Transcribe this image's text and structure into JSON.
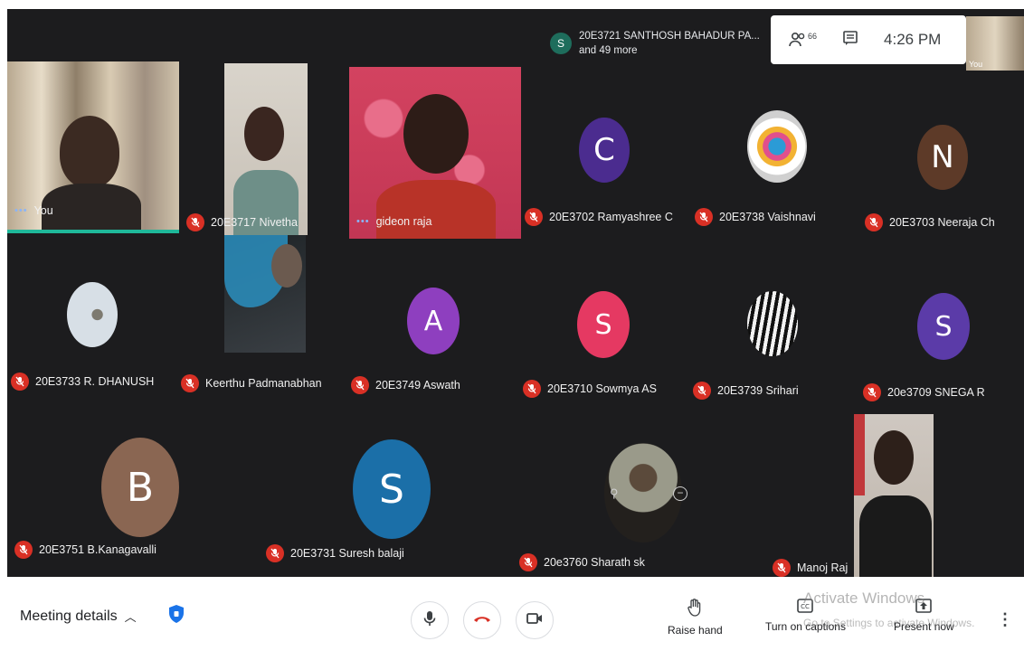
{
  "presenter": {
    "initial": "S",
    "name": "20E3721 SANTHOSH BAHADUR PA...",
    "more": "and 49 more"
  },
  "top_bar": {
    "participants_icon": "people-icon",
    "participants_count": "66",
    "chat_icon": "chat-icon",
    "time": "4:26 PM",
    "self_view_label": "You"
  },
  "tiles": [
    {
      "name": "You",
      "type": "video",
      "speaking": true
    },
    {
      "name": "20E3717 Nivetha",
      "type": "video",
      "muted": true
    },
    {
      "name": "gideon raja",
      "type": "video",
      "speaking": true
    },
    {
      "name": "20E3702 Ramyashree C",
      "type": "avatar",
      "initial": "C",
      "color": "#4b2c8f",
      "muted": true
    },
    {
      "name": "20E3738 Vaishnavi",
      "type": "photo",
      "muted": true
    },
    {
      "name": "20E3703 Neeraja Ch",
      "type": "avatar",
      "initial": "N",
      "color": "#5d3a28",
      "muted": true
    },
    {
      "name": "20E3733 R. DHANUSH",
      "type": "photo",
      "muted": true
    },
    {
      "name": "Keerthu Padmanabhan",
      "type": "video",
      "muted": true
    },
    {
      "name": "20E3749 Aswath",
      "type": "avatar",
      "initial": "A",
      "color": "#8e3fbf",
      "muted": true
    },
    {
      "name": "20E3710 Sowmya AS",
      "type": "avatar",
      "initial": "S",
      "color": "#e53962",
      "muted": true
    },
    {
      "name": "20E3739 Srihari",
      "type": "photo",
      "muted": true
    },
    {
      "name": "20e3709 SNEGA R",
      "type": "avatar",
      "initial": "S",
      "color": "#5b3ba8",
      "muted": true
    },
    {
      "name": "20E3751 B.Kanagavalli",
      "type": "avatar",
      "initial": "B",
      "color": "#8a6652",
      "muted": true
    },
    {
      "name": "20E3731 Suresh balaji",
      "type": "avatar",
      "initial": "S",
      "color": "#1b6fa8",
      "muted": true
    },
    {
      "name": "20e3760 Sharath sk",
      "type": "photo",
      "muted": true
    },
    {
      "name": "Manoj Raj",
      "type": "video",
      "muted": true
    }
  ],
  "controls": {
    "meeting_details": "Meeting details",
    "mic_icon": "microphone-icon",
    "hangup_icon": "hang-up-icon",
    "camera_icon": "camera-icon",
    "raise_hand": "Raise hand",
    "captions": "Turn on captions",
    "present": "Present now",
    "more_icon": "more-vertical-icon"
  },
  "watermark": {
    "title": "Activate Windows",
    "subtitle": "Go to Settings to activate Windows."
  },
  "colors": {
    "mute_red": "#d93025",
    "stage_bg": "#1c1c1e",
    "shield_blue": "#1a73e8"
  }
}
